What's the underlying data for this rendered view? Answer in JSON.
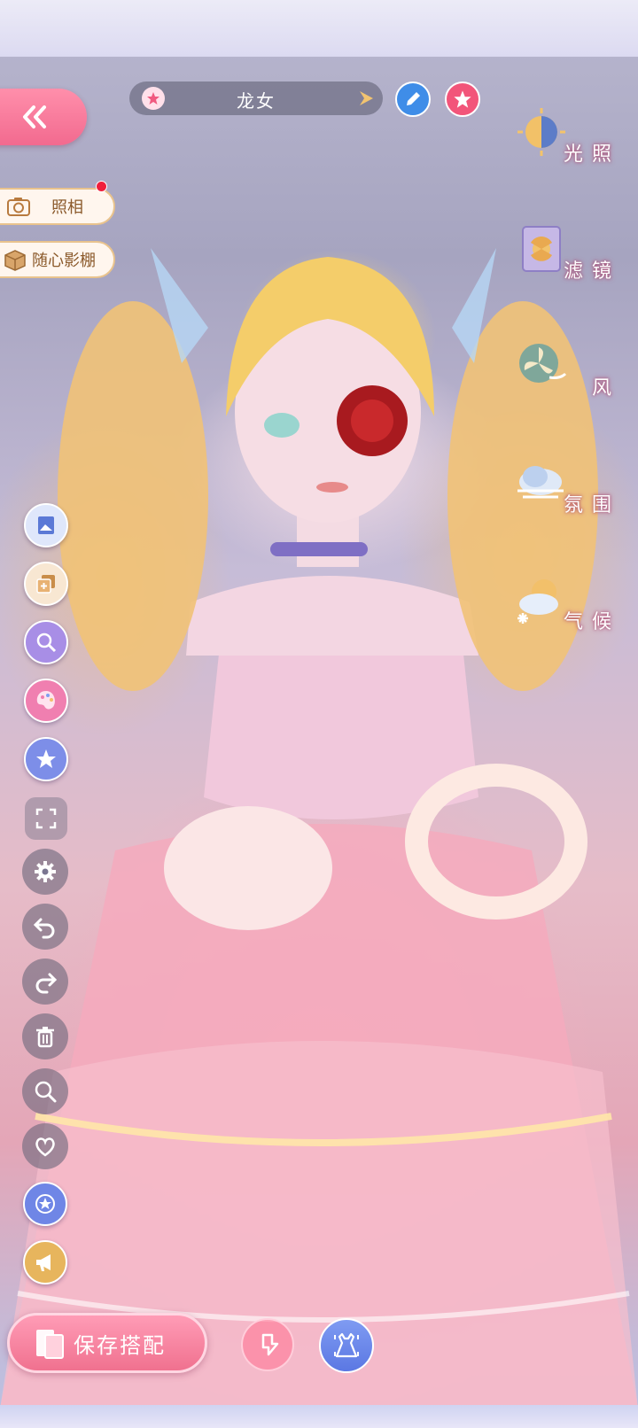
{
  "header": {
    "outfit_name": "龙女"
  },
  "left_actions": {
    "photo_label": "照相",
    "studio_label": "随心影棚"
  },
  "environment": {
    "items": [
      {
        "label": "光照",
        "icon": "light-icon"
      },
      {
        "label": "滤镜",
        "icon": "filter-icon"
      },
      {
        "label": "风",
        "icon": "wind-icon"
      },
      {
        "label": "氛围",
        "icon": "atmosphere-icon"
      },
      {
        "label": "气候",
        "icon": "climate-icon"
      }
    ]
  },
  "toolbar": {
    "icons": [
      "background-icon",
      "copy-icon",
      "pose-search-icon",
      "palette-icon",
      "star-effects-icon",
      "fullscreen-icon",
      "settings-icon",
      "undo-icon",
      "redo-icon",
      "trash-icon",
      "zoom-icon",
      "heart-icon",
      "star-badge-icon",
      "megaphone-icon"
    ]
  },
  "footer": {
    "save_label": "保存搭配"
  },
  "colors": {
    "accent_pink": "#f26a8f",
    "accent_blue": "#3f8de8",
    "pill_border": "#e9c38d",
    "pill_text": "#8b5a2b"
  }
}
